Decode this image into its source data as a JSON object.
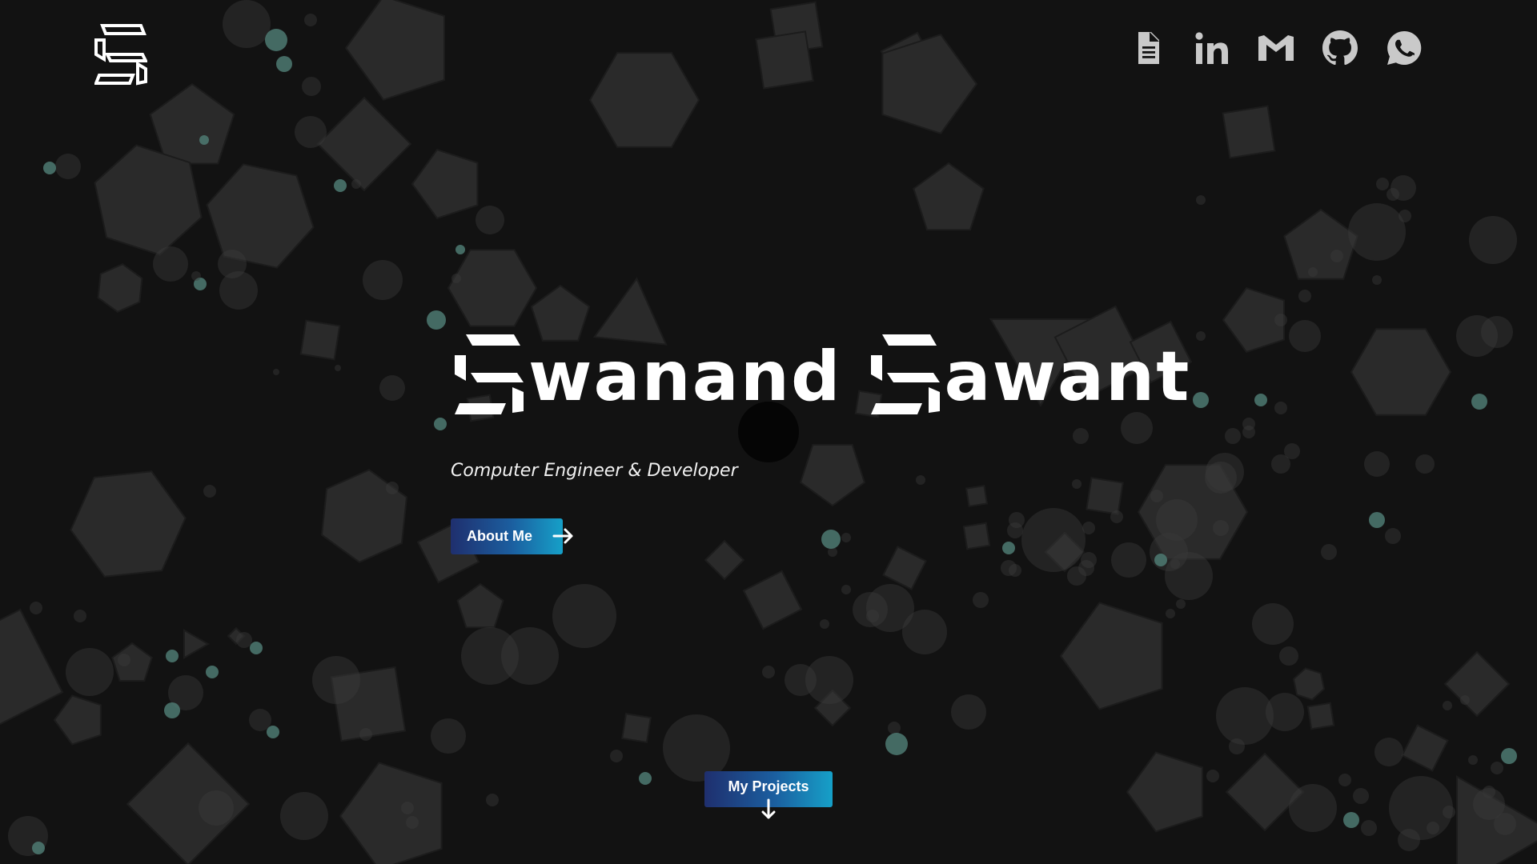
{
  "brand": {
    "logo_icon": "ss-monogram-logo-icon"
  },
  "socials": [
    {
      "name": "resume-icon",
      "label": "Resume"
    },
    {
      "name": "linkedin-icon",
      "label": "LinkedIn"
    },
    {
      "name": "gmail-icon",
      "label": "Gmail"
    },
    {
      "name": "github-icon",
      "label": "GitHub"
    },
    {
      "name": "whatsapp-icon",
      "label": "WhatsApp"
    }
  ],
  "hero": {
    "first_initial": "S",
    "first_rest": "wanand",
    "last_initial": "S",
    "last_rest": "awant",
    "subtitle": "Computer Engineer & Developer"
  },
  "buttons": {
    "about_label": "About Me",
    "projects_label": "My Projects"
  },
  "colors": {
    "background": "#121212",
    "shape": "#2a2a2a",
    "bubble": "#3a3a3a",
    "bubble_accent": "#4e7a72",
    "gradient_start": "#1f2f6e",
    "gradient_end": "#16a0c8",
    "icon": "#c9c9c9",
    "text": "#ffffff"
  }
}
